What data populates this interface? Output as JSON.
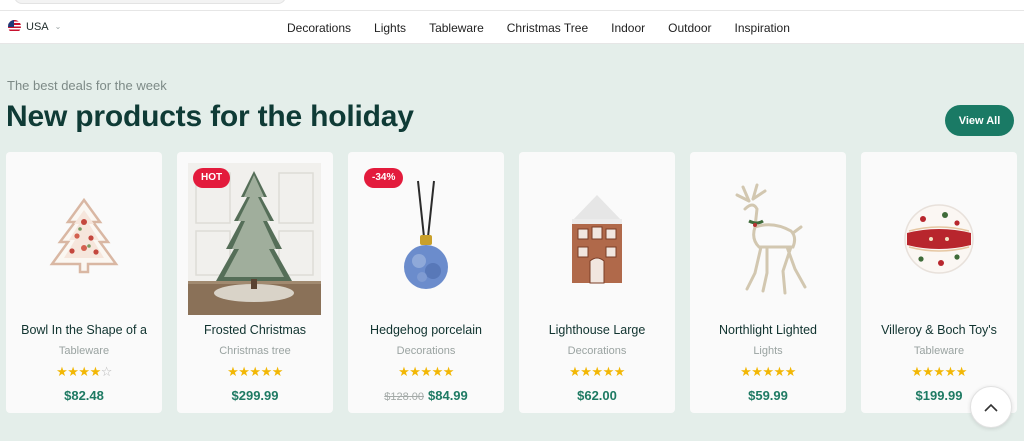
{
  "region": {
    "label": "USA",
    "flag_icon": "us-flag-icon",
    "chevron_icon": "chevron-down-icon"
  },
  "nav": {
    "items": [
      "Decorations",
      "Lights",
      "Tableware",
      "Christmas Tree",
      "Indoor",
      "Outdoor",
      "Inspiration"
    ]
  },
  "section": {
    "kicker": "The best deals for the week",
    "title": "New products for the holiday",
    "view_all": "View All"
  },
  "colors": {
    "accent": "#1a7a65",
    "title": "#0f3b36",
    "badge": "#e31b3c",
    "star": "#f2b705",
    "background": "#e4eeea"
  },
  "products": [
    {
      "name": "Bowl In the Shape of a",
      "category": "Tableware",
      "rating": 4,
      "price": "$82.48",
      "old_price": "",
      "badge": "",
      "image_icon": "tree-bowl-icon"
    },
    {
      "name": "Frosted Christmas",
      "category": "Christmas tree",
      "rating": 5,
      "price": "$299.99",
      "old_price": "",
      "badge": "HOT",
      "image_icon": "christmas-tree-photo"
    },
    {
      "name": "Hedgehog porcelain",
      "category": "Decorations",
      "rating": 5,
      "price": "$84.99",
      "old_price": "$128.00",
      "badge": "-34%",
      "image_icon": "ornament-icon"
    },
    {
      "name": "Lighthouse Large",
      "category": "Decorations",
      "rating": 5,
      "price": "$62.00",
      "old_price": "",
      "badge": "",
      "image_icon": "gingerbread-house-icon"
    },
    {
      "name": "Northlight Lighted",
      "category": "Lights",
      "rating": 5,
      "price": "$59.99",
      "old_price": "",
      "badge": "",
      "image_icon": "reindeer-icon"
    },
    {
      "name": "Villeroy & Boch Toy's",
      "category": "Tableware",
      "rating": 5,
      "price": "$199.99",
      "old_price": "",
      "badge": "",
      "image_icon": "bauble-icon"
    }
  ],
  "back_to_top_icon": "chevron-up-icon"
}
